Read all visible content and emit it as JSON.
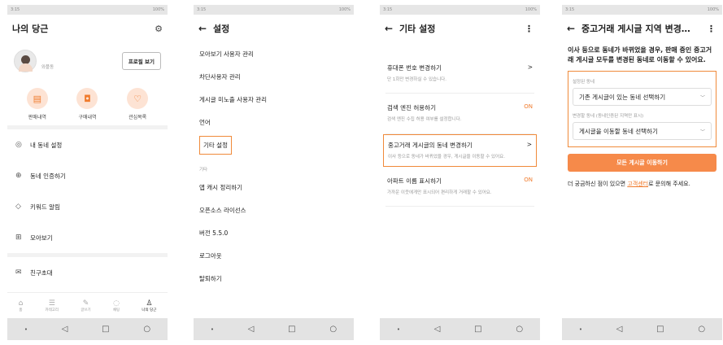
{
  "status": {
    "time": "3:15",
    "right": "100%"
  },
  "screen1": {
    "title": "나의 당근",
    "user_name": "와플동",
    "profile_button": "프로필 보기",
    "quick": [
      {
        "icon": "receipt-icon",
        "label": "판매내역"
      },
      {
        "icon": "bag-icon",
        "label": "구매내역"
      },
      {
        "icon": "heart-icon",
        "label": "관심목록"
      }
    ],
    "menu": [
      {
        "icon": "location-icon",
        "label": "내 동네 설정"
      },
      {
        "icon": "target-icon",
        "label": "동네 인증하기"
      },
      {
        "icon": "tag-icon",
        "label": "키워드 알림"
      },
      {
        "icon": "grid-icon",
        "label": "모아보기"
      },
      {
        "icon": "mail-icon",
        "label": "친구초대"
      }
    ],
    "tabs": [
      {
        "icon": "home-icon",
        "label": "홈"
      },
      {
        "icon": "menu-icon",
        "label": "카테고리"
      },
      {
        "icon": "pencil-icon",
        "label": "글쓰기"
      },
      {
        "icon": "chat-icon",
        "label": "채팅"
      },
      {
        "icon": "person-icon",
        "label": "나의 당근"
      }
    ]
  },
  "screen2": {
    "title": "설정",
    "items": [
      "모아보기 사용자 관리",
      "차단사용자 관리",
      "게시글 미노출 사용자 관리",
      "언어",
      "기타 설정"
    ],
    "section_label": "기타",
    "items2": [
      "앱 캐시 정리하기",
      "오픈소스 라이선스",
      "버전 5.5.0",
      "로그아웃",
      "탈퇴하기"
    ]
  },
  "screen3": {
    "title": "기타 설정",
    "options": [
      {
        "title": "휴대폰 번호 변경하기",
        "desc": "단 1회만 변경하실 수 있습니다.",
        "right": ">"
      },
      {
        "title": "검색 엔진 허용하기",
        "desc": "검색 엔진 수집 허용 여부를 설정합니다.",
        "right": "ON"
      },
      {
        "title": "중고거래 게시글의 동네 변경하기",
        "desc": "이사 등으로 동네가 바뀌었을 경우, 게시글을 이동할 수 있어요.",
        "right": ">"
      },
      {
        "title": "아파트 이름 표시하기",
        "desc": "가까운 이웃에게만 표시되어 편리하게 거래할 수 있어요.",
        "right": "ON"
      }
    ]
  },
  "screen4": {
    "title": "중고거래 게시글 지역 변경…",
    "lead": "이사 등으로 동네가 바뀌었을 경우, 판매 중인 중고거래 게시글 모두를 변경된 동네로 이동할 수 있어요.",
    "label1": "설정된 동네",
    "select1": "기존 게시글이 있는 동네 선택하기",
    "label2": "변경할 동네 (동네인증된 지역만 표시)",
    "select2": "게시글을 이동할 동네 선택하기",
    "button": "모든 게시글 이동하기",
    "help_pre": "더 궁금하신 점이 있으면 ",
    "help_link": "고객센터",
    "help_post": "로 문의해 주세요."
  },
  "accent": "#f68a4a"
}
